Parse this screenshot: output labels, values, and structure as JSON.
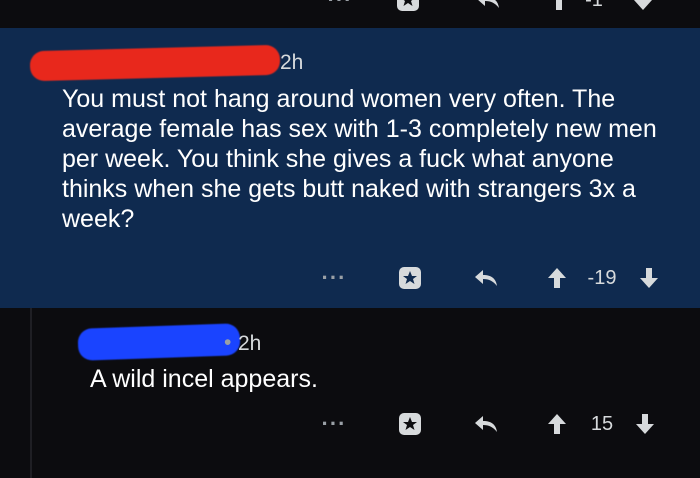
{
  "top_partial": {
    "score": "-1"
  },
  "parent_comment": {
    "author": "",
    "time": "2h",
    "body": "You must not hang around women very often. The average female has sex with 1-3 completely new men per week. You think she gives a fuck what anyone thinks when she gets butt naked with strangers 3x a week?",
    "more": "···",
    "score": "-19"
  },
  "reply_comment": {
    "author": "",
    "time": "2h",
    "separator": "•",
    "body": "A wild incel appears.",
    "more": "···",
    "score": "15"
  },
  "colors": {
    "background": "#0c0c0f",
    "highlight": "#0f2a4f",
    "text": "#ffffff",
    "icon": "#d7dadc"
  }
}
